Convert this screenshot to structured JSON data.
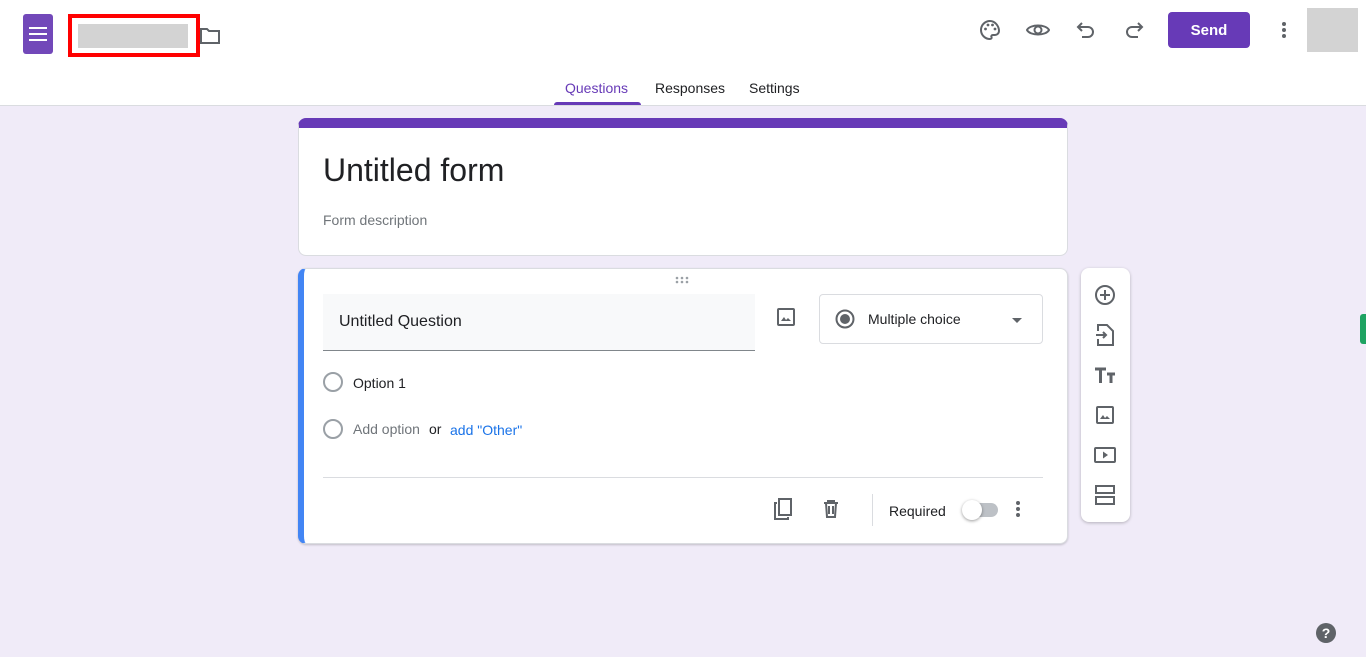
{
  "header": {
    "send_label": "Send",
    "colors": {
      "accent": "#673ab7",
      "question_border": "#4285f4",
      "background": "#f0ebf8"
    }
  },
  "tabs": [
    {
      "label": "Questions",
      "active": true
    },
    {
      "label": "Responses"
    },
    {
      "label": "Settings"
    }
  ],
  "form": {
    "title": "Untitled form",
    "description_placeholder": "Form description"
  },
  "question": {
    "title": "Untitled Question",
    "type": "Multiple choice",
    "option1": "Option 1",
    "add_option": "Add option",
    "or": "or",
    "add_other": "add \"Other\"",
    "required_label": "Required",
    "required": false
  },
  "help": "?"
}
